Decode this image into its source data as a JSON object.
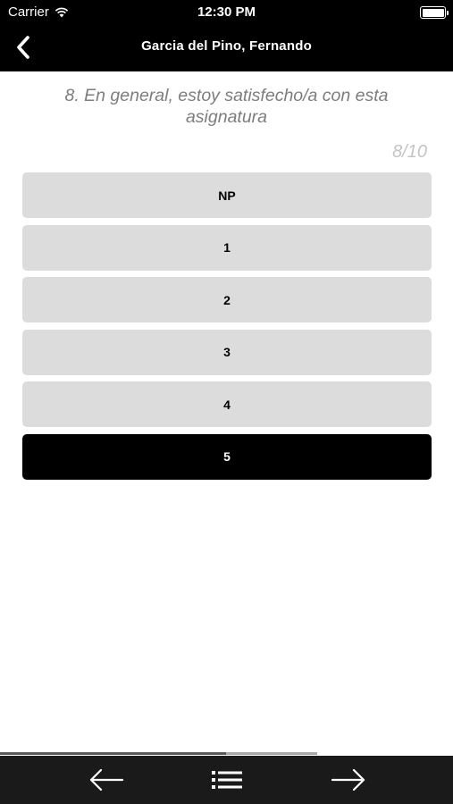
{
  "status_bar": {
    "carrier": "Carrier",
    "time": "12:30 PM"
  },
  "nav": {
    "title": "Garcia del Pino, Fernando",
    "back_icon": "chevron-left-icon"
  },
  "question": {
    "text": "8. En general, estoy satisfecho/a con esta asignatura",
    "progress": "8/10"
  },
  "options": [
    {
      "label": "NP",
      "selected": false
    },
    {
      "label": "1",
      "selected": false
    },
    {
      "label": "2",
      "selected": false
    },
    {
      "label": "3",
      "selected": false
    },
    {
      "label": "4",
      "selected": false
    },
    {
      "label": "5",
      "selected": true
    }
  ],
  "progress_bar": {
    "current": 8,
    "total": 10,
    "fraction": 0.7
  },
  "toolbar": {
    "prev_icon": "arrow-left-icon",
    "list_icon": "list-icon",
    "next_icon": "arrow-right-icon"
  },
  "colors": {
    "bar_bg": "#000000",
    "option_bg": "#dcdcdc",
    "option_selected_bg": "#000000",
    "question_text": "#7d7d7d"
  }
}
